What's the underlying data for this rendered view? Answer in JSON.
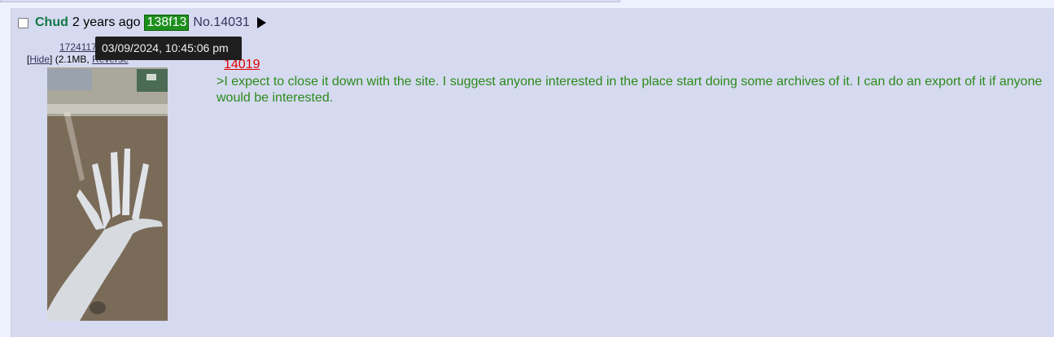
{
  "post": {
    "name": "Chud",
    "age": "2 years ago",
    "id": "138f13",
    "number": "No.14031",
    "tooltip": "03/09/2024, 10:45:06 pm",
    "file": {
      "link_partial": "1724117",
      "hide": "Hide",
      "meta_partial": "(2.1MB,",
      "reverse_partial": "Reverse"
    },
    "quote_partial": "14019",
    "message": ">I expect to close it down with the site. I suggest anyone interested in the place start doing some archives of it. I can do an export of it if anyone would be interested."
  },
  "colors": {
    "post_bg": "#d6daf0",
    "page_bg": "#eef2ff",
    "name": "#117743",
    "id_bg": "#1c8f1c",
    "greentext": "#2a8a1a",
    "quote": "#dd0000"
  },
  "icons": {
    "expand": "triangle-right-icon"
  }
}
